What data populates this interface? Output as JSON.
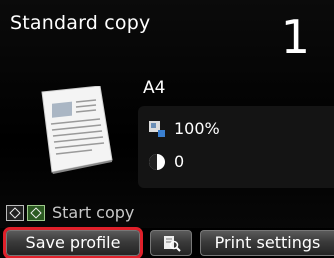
{
  "screen": {
    "title": "Standard copy",
    "copies": "1",
    "paper_size": "A4",
    "magnification": "100%",
    "density": "0",
    "start_hint": "Start copy"
  },
  "buttons": {
    "left_label": "Save profile",
    "right_label": "Print settings"
  },
  "icons": {
    "document": "document-preview-icon",
    "magnification": "magnification-icon",
    "density": "density-icon",
    "black_key": "black-start-key-icon",
    "color_key": "color-start-key-icon",
    "preview": "preview-magnifier-icon"
  },
  "colors": {
    "highlight": "#e0202a",
    "background": "#000000",
    "color_key": "#2c5a22"
  }
}
